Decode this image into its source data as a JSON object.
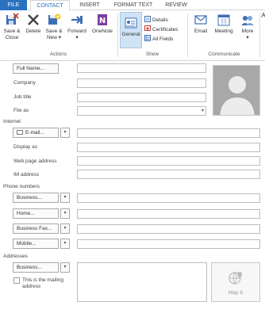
{
  "tabs": {
    "file": "FILE",
    "contact": "CONTACT",
    "insert": "INSERT",
    "format_text": "FORMAT TEXT",
    "review": "REVIEW"
  },
  "ribbon": {
    "actions": {
      "label": "Actions",
      "save_close_line1": "Save &",
      "save_close_line2": "Close",
      "delete": "Delete",
      "save_new_line1": "Save &",
      "save_new_line2": "New",
      "forward": "Forward",
      "onenote": "OneNote"
    },
    "show": {
      "label": "Show",
      "general": "General",
      "details": "Details",
      "certificates": "Certificates",
      "all_fields": "All Fields"
    },
    "communicate": {
      "label": "Communicate",
      "email": "Email",
      "meeting": "Meeting",
      "more": "More"
    },
    "overflow_letter": "A"
  },
  "form": {
    "full_name_button": "Full Name...",
    "company": "Company",
    "job_title": "Job title",
    "file_as": "File as",
    "internet_section": "Internet",
    "email_button": "E-mail...",
    "display_as": "Display as",
    "web_page": "Web page address",
    "im_address": "IM address",
    "phone_section": "Phone numbers",
    "phone_buttons": [
      "Business...",
      "Home...",
      "Business Fax...",
      "Mobile..."
    ],
    "addresses_section": "Addresses",
    "address_button": "Business...",
    "mailing_line1": "This is the mailing",
    "mailing_line2": "address",
    "map_it": "Map It"
  },
  "colors": {
    "accent": "#2a72c0",
    "onenote": "#7b3f9e",
    "selected": "#cfe3f5"
  }
}
